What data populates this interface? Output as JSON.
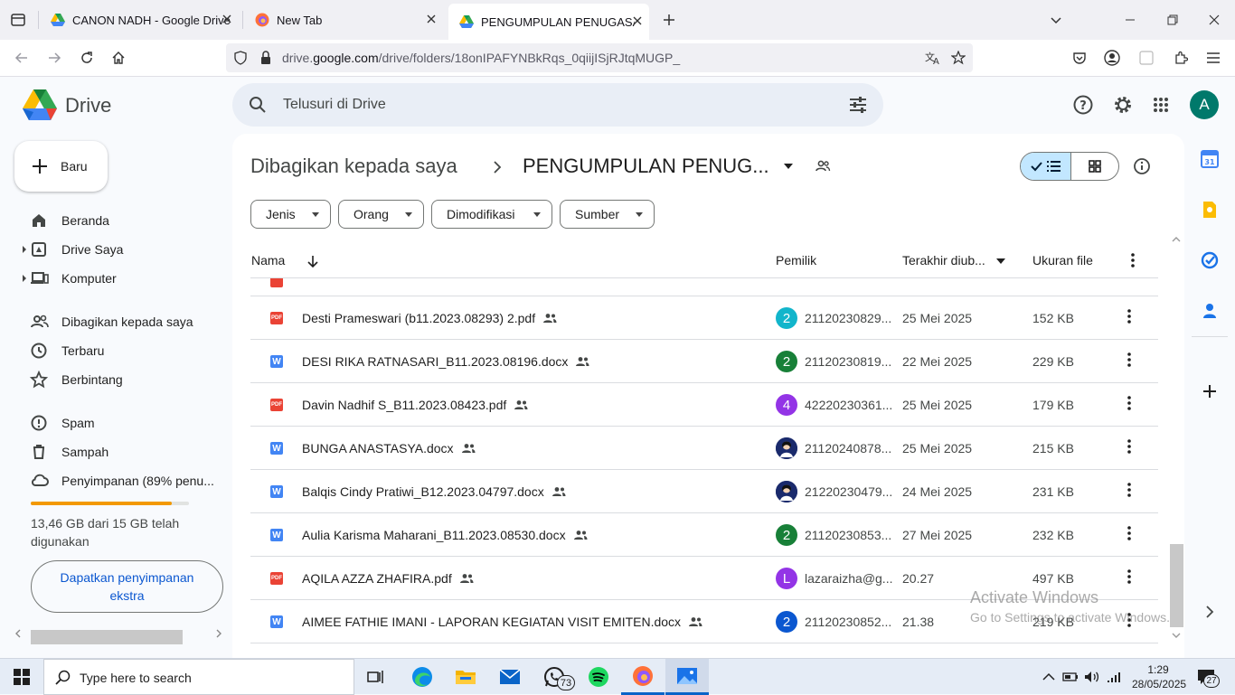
{
  "browser": {
    "tabs": [
      {
        "title": "CANON NADH - Google Drive",
        "icon": "google-drive-icon"
      },
      {
        "title": "New Tab",
        "icon": "firefox-icon"
      },
      {
        "title": "PENGUMPULAN PENUGASAN \\",
        "icon": "google-drive-icon",
        "active": true
      }
    ],
    "url_prefix": "drive.",
    "url_domain": "google.com",
    "url_rest": "/drive/folders/18onIPAFYNBkRqs_0qiijISjRJtqMUGP_"
  },
  "drive": {
    "app_name": "Drive",
    "search_placeholder": "Telusuri di Drive",
    "account_initial": "A",
    "new_button": "Baru",
    "nav": [
      {
        "label": "Beranda",
        "icon": "home-icon"
      },
      {
        "label": "Drive Saya",
        "icon": "my-drive-icon"
      },
      {
        "label": "Komputer",
        "icon": "computer-icon"
      },
      {
        "label": "Dibagikan kepada saya",
        "icon": "shared-icon"
      },
      {
        "label": "Terbaru",
        "icon": "clock-icon"
      },
      {
        "label": "Berbintang",
        "icon": "star-icon"
      },
      {
        "label": "Spam",
        "icon": "spam-icon"
      },
      {
        "label": "Sampah",
        "icon": "trash-icon"
      },
      {
        "label": "Penyimpanan (89% penu...",
        "icon": "cloud-icon"
      }
    ],
    "storage": {
      "used_fraction": 0.89,
      "text": "13,46 GB dari 15 GB telah digunakan",
      "button": "Dapatkan penyimpanan ekstra"
    },
    "breadcrumb": {
      "parent": "Dibagikan kepada saya",
      "current": "PENGUMPULAN PENUG..."
    },
    "filters": [
      "Jenis",
      "Orang",
      "Dimodifikasi",
      "Sumber"
    ],
    "columns": {
      "name": "Nama",
      "owner": "Pemilik",
      "modified": "Terakhir diub...",
      "size": "Ukuran file"
    },
    "files": [
      {
        "name": "Desti Prameswari (b11.2023.08293) 2.pdf",
        "type": "pdf",
        "avatar": "2",
        "avatar_color": "#12b5cb",
        "owner": "21120230829...",
        "modified": "25 Mei 2025",
        "size": "152 KB"
      },
      {
        "name": "DESI RIKA RATNASARI_B11.2023.08196.docx",
        "type": "docx",
        "avatar": "2",
        "avatar_color": "#188038",
        "owner": "21120230819...",
        "modified": "22 Mei 2025",
        "size": "229 KB"
      },
      {
        "name": "Davin Nadhif S_B11.2023.08423.pdf",
        "type": "pdf",
        "avatar": "4",
        "avatar_color": "#9334e6",
        "owner": "42220230361...",
        "modified": "25 Mei 2025",
        "size": "179 KB"
      },
      {
        "name": "BUNGA ANASTASYA.docx",
        "type": "docx",
        "avatar": "",
        "avatar_color": "#1a2a6c",
        "owner": "21120240878...",
        "modified": "25 Mei 2025",
        "size": "215 KB"
      },
      {
        "name": "Balqis Cindy Pratiwi_B12.2023.04797.docx",
        "type": "docx",
        "avatar": "",
        "avatar_color": "#1a2a6c",
        "owner": "21220230479...",
        "modified": "24 Mei 2025",
        "size": "231 KB"
      },
      {
        "name": "Aulia Karisma Maharani_B11.2023.08530.docx",
        "type": "docx",
        "avatar": "2",
        "avatar_color": "#188038",
        "owner": "21120230853...",
        "modified": "27 Mei 2025",
        "size": "232 KB"
      },
      {
        "name": "AQILA AZZA ZHAFIRA.pdf",
        "type": "pdf",
        "avatar": "L",
        "avatar_color": "#9334e6",
        "owner": "lazaraizha@g...",
        "modified": "20.27",
        "size": "497 KB"
      },
      {
        "name": "AIMEE FATHIE IMANI - LAPORAN KEGIATAN VISIT EMITEN.docx",
        "type": "docx",
        "avatar": "2",
        "avatar_color": "#0b57d0",
        "owner": "21120230852...",
        "modified": "21.38",
        "size": "219 KB"
      }
    ],
    "watermark_line1": "Activate Windows",
    "watermark_line2": "Go to Settings to activate Windows."
  },
  "taskbar": {
    "search_placeholder": "Type here to search",
    "whatsapp_badge": "73",
    "time": "1:29",
    "date": "28/05/2025",
    "notification_count": "27"
  }
}
